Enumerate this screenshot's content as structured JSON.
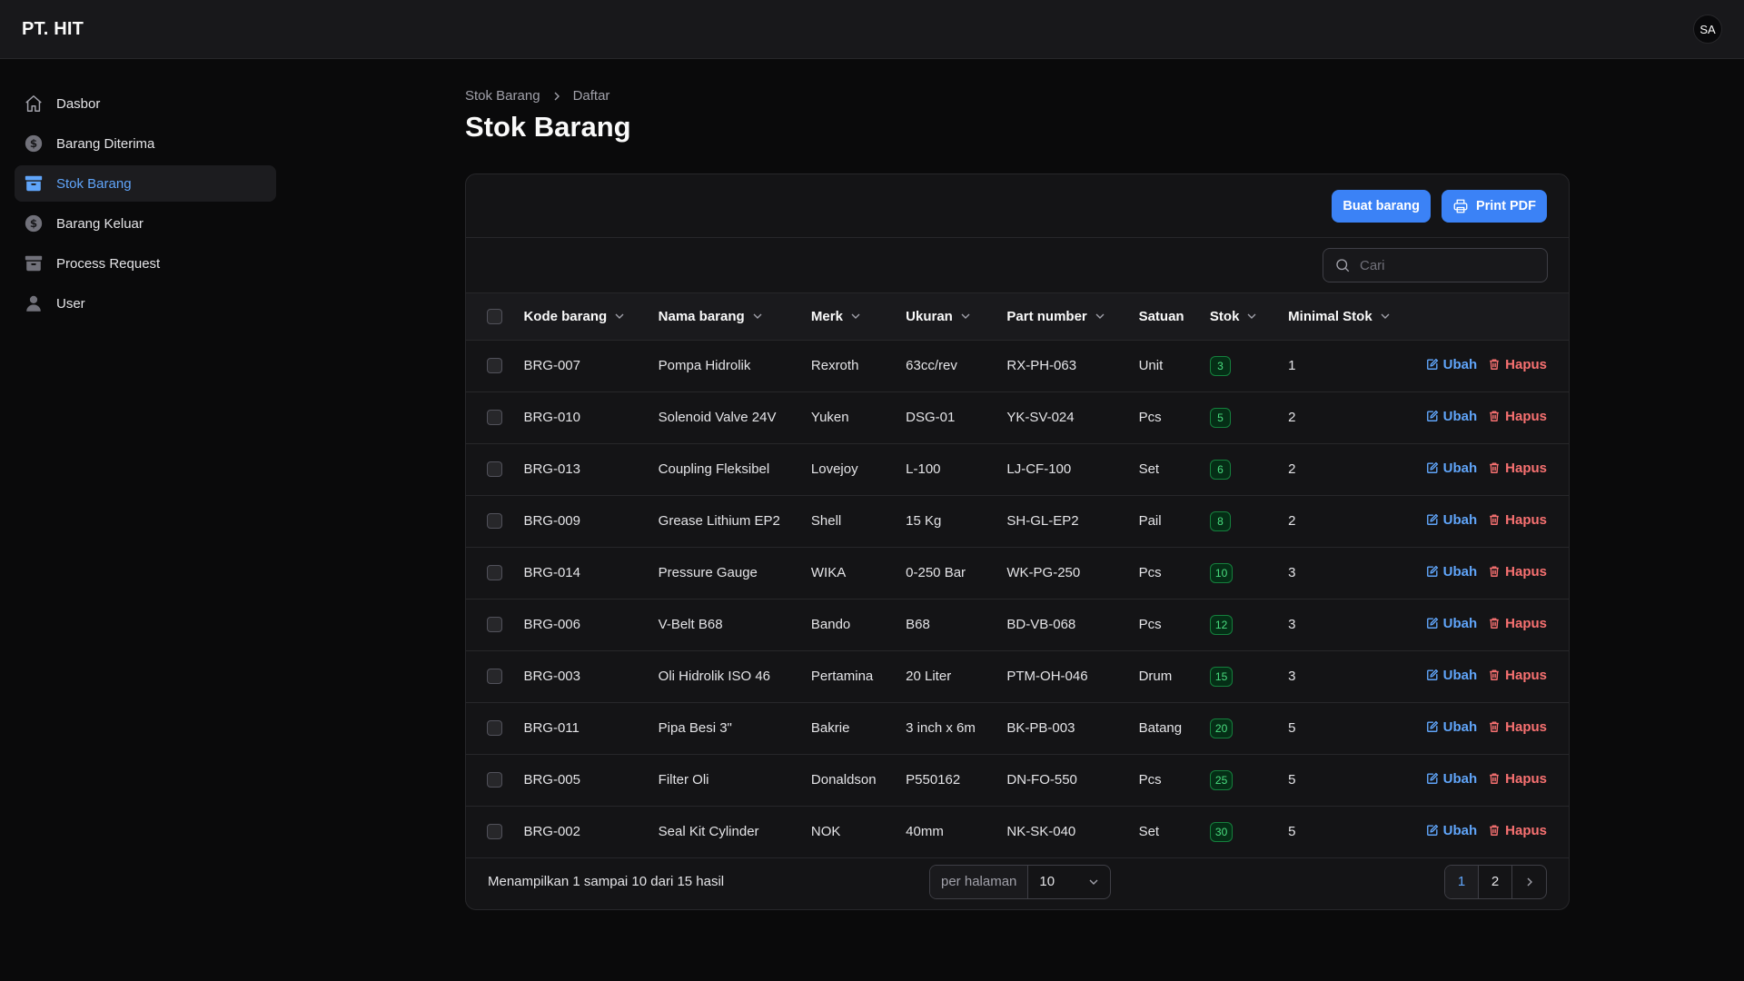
{
  "app": {
    "brand": "PT. HIT",
    "avatar_initials": "SA"
  },
  "sidebar": {
    "items": [
      {
        "label": "Dasbor",
        "icon": "home-icon",
        "active": false
      },
      {
        "label": "Barang Diterima",
        "icon": "dollar-circle-icon",
        "active": false
      },
      {
        "label": "Stok Barang",
        "icon": "archive-box-icon",
        "active": true
      },
      {
        "label": "Barang Keluar",
        "icon": "dollar-circle-icon",
        "active": false
      },
      {
        "label": "Process Request",
        "icon": "archive-box-icon",
        "active": false
      },
      {
        "label": "User",
        "icon": "user-icon",
        "active": false
      }
    ]
  },
  "breadcrumb": {
    "parent": "Stok Barang",
    "current": "Daftar"
  },
  "page": {
    "title": "Stok Barang"
  },
  "toolbar": {
    "create_label": "Buat barang",
    "print_label": "Print PDF"
  },
  "search": {
    "placeholder": "Cari",
    "value": ""
  },
  "table": {
    "columns": [
      "Kode barang",
      "Nama barang",
      "Merk",
      "Ukuran",
      "Part number",
      "Satuan",
      "Stok",
      "Minimal Stok"
    ],
    "edit_label": "Ubah",
    "delete_label": "Hapus",
    "rows": [
      {
        "kode": "BRG-007",
        "nama": "Pompa Hidrolik",
        "merk": "Rexroth",
        "ukuran": "63cc/rev",
        "part": "RX-PH-063",
        "satuan": "Unit",
        "stok": "3",
        "min": "1"
      },
      {
        "kode": "BRG-010",
        "nama": "Solenoid Valve 24V",
        "merk": "Yuken",
        "ukuran": "DSG-01",
        "part": "YK-SV-024",
        "satuan": "Pcs",
        "stok": "5",
        "min": "2"
      },
      {
        "kode": "BRG-013",
        "nama": "Coupling Fleksibel",
        "merk": "Lovejoy",
        "ukuran": "L-100",
        "part": "LJ-CF-100",
        "satuan": "Set",
        "stok": "6",
        "min": "2"
      },
      {
        "kode": "BRG-009",
        "nama": "Grease Lithium EP2",
        "merk": "Shell",
        "ukuran": "15 Kg",
        "part": "SH-GL-EP2",
        "satuan": "Pail",
        "stok": "8",
        "min": "2"
      },
      {
        "kode": "BRG-014",
        "nama": "Pressure Gauge",
        "merk": "WIKA",
        "ukuran": "0-250 Bar",
        "part": "WK-PG-250",
        "satuan": "Pcs",
        "stok": "10",
        "min": "3"
      },
      {
        "kode": "BRG-006",
        "nama": "V-Belt B68",
        "merk": "Bando",
        "ukuran": "B68",
        "part": "BD-VB-068",
        "satuan": "Pcs",
        "stok": "12",
        "min": "3"
      },
      {
        "kode": "BRG-003",
        "nama": "Oli Hidrolik ISO 46",
        "merk": "Pertamina",
        "ukuran": "20 Liter",
        "part": "PTM-OH-046",
        "satuan": "Drum",
        "stok": "15",
        "min": "3"
      },
      {
        "kode": "BRG-011",
        "nama": "Pipa Besi 3\"",
        "merk": "Bakrie",
        "ukuran": "3 inch x 6m",
        "part": "BK-PB-003",
        "satuan": "Batang",
        "stok": "20",
        "min": "5"
      },
      {
        "kode": "BRG-005",
        "nama": "Filter Oli",
        "merk": "Donaldson",
        "ukuran": "P550162",
        "part": "DN-FO-550",
        "satuan": "Pcs",
        "stok": "25",
        "min": "5"
      },
      {
        "kode": "BRG-002",
        "nama": "Seal Kit Cylinder",
        "merk": "NOK",
        "ukuran": "40mm",
        "part": "NK-SK-040",
        "satuan": "Set",
        "stok": "30",
        "min": "5"
      }
    ]
  },
  "footer": {
    "info": "Menampilkan 1 sampai 10 dari 15 hasil",
    "per_page_label": "per halaman",
    "per_page_value": "10",
    "pages": [
      "1",
      "2"
    ],
    "current_page": "1"
  },
  "colors": {
    "accent": "#3b82f6",
    "danger": "#f87171",
    "success": "#4ade80",
    "background": "#0a0a0b"
  }
}
